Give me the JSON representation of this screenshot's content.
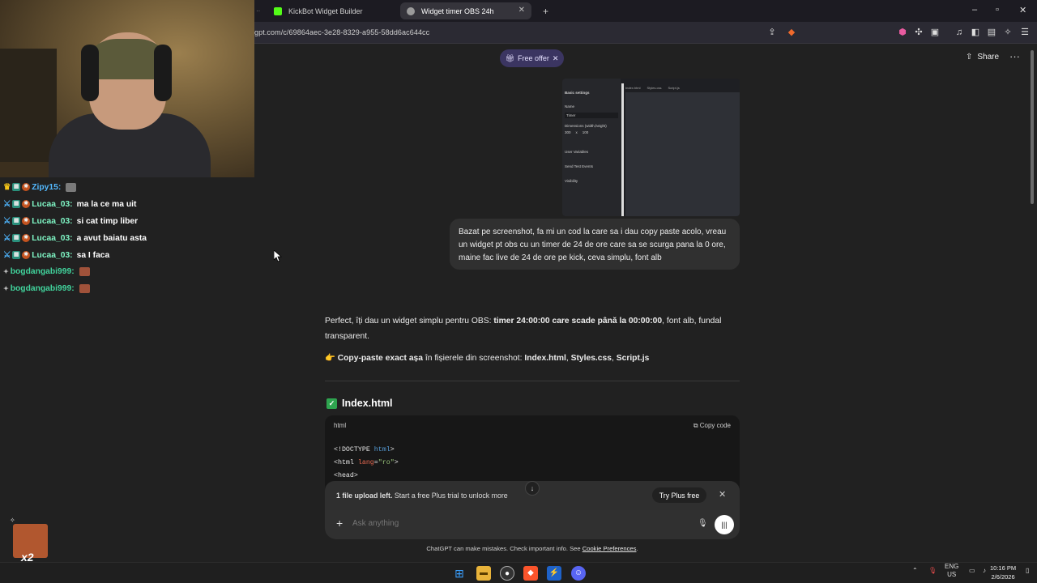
{
  "browser": {
    "tabs": [
      {
        "title": "KickBot Widget Builder",
        "active": false
      },
      {
        "title": "Widget timer OBS 24h",
        "active": true
      }
    ],
    "new_tab": "+",
    "url": "gpt.com/c/69864aec-3e28-8329-a955-58dd6ac644cc",
    "window_controls": [
      "–",
      "▫",
      "✕"
    ]
  },
  "chatgpt": {
    "free_offer": "Free offer",
    "share": "Share",
    "more": "···",
    "screenshot": {
      "sidebar_rows": [
        "Basic settings",
        "Name",
        "Timer",
        "Dimensions (width,height)",
        "User Variables",
        "Send Test Events",
        "Visibility"
      ],
      "dims": [
        "300",
        "x",
        "100"
      ],
      "tabs": [
        "Index.html",
        "Styles.css",
        "Script.js"
      ]
    },
    "user_message": "Bazat pe screenshot, fa mi un cod la care sa i dau copy paste acolo, vreau un widget pt obs cu un timer de 24 de ore care sa se scurga pana la 0 ore, maine fac live de 24 de ore pe kick, ceva simplu, font alb",
    "reply": {
      "p1_a": "Perfect, îți dau un widget simplu pentru OBS: ",
      "p1_b": "timer 24:00:00 care scade până la 00:00:00",
      "p1_c": ", font alb, fundal transparent.",
      "p2_emoji": "👉",
      "p2_a": "Copy-paste exact așa",
      "p2_b": " în fișierele din screenshot: ",
      "p2_c": "Index.html",
      "p2_d": ", ",
      "p2_e": "Styles.css",
      "p2_f": ", ",
      "p2_g": "Script.js",
      "section_title": "Index.html",
      "code_lang": "html",
      "copy_code": "Copy code"
    },
    "banner": {
      "bold": "1 file upload left.",
      "rest": " Start a free Plus trial to unlock more",
      "button": "Try Plus free"
    },
    "composer_placeholder": "Ask anything",
    "disclaimer_a": "ChatGPT can make mistakes. Check important info. See ",
    "disclaimer_link": "Cookie Preferences",
    "disclaimer_b": "."
  },
  "stream_chat": [
    {
      "user": "Zipy15:",
      "text": "",
      "color": "#53b9ff",
      "badges": [
        "crown-icon",
        "subscriber-badge",
        "kick-badge"
      ],
      "emote": true
    },
    {
      "user": "Lucaa_03:",
      "text": "ma la ce ma uit",
      "color": "#7ff6c5",
      "badges": [
        "sword-icon",
        "subscriber-badge",
        "kick-badge"
      ],
      "emote": false
    },
    {
      "user": "Lucaa_03:",
      "text": "si cat timp liber",
      "color": "#7ff6c5",
      "badges": [
        "sword-icon",
        "subscriber-badge",
        "kick-badge"
      ],
      "emote": false
    },
    {
      "user": "Lucaa_03:",
      "text": "a avut baiatu asta",
      "color": "#7ff6c5",
      "badges": [
        "sword-icon",
        "subscriber-badge",
        "kick-badge"
      ],
      "emote": false
    },
    {
      "user": "Lucaa_03:",
      "text": "sa I faca",
      "color": "#7ff6c5",
      "badges": [
        "sword-icon",
        "subscriber-badge",
        "kick-badge"
      ],
      "emote": false
    },
    {
      "user": "bogdangabi999:",
      "text": "",
      "color": "#41d39c",
      "badges": [
        "sparkle-badge"
      ],
      "emote": true
    },
    {
      "user": "bogdangabi999:",
      "text": "",
      "color": "#41d39c",
      "badges": [
        "sparkle-badge"
      ],
      "emote": true
    }
  ],
  "gift": {
    "multiplier": "x2"
  },
  "taskbar": {
    "lang_top": "ENG",
    "lang_bottom": "US",
    "time": "10:16 PM",
    "date": "2/6/2026"
  }
}
